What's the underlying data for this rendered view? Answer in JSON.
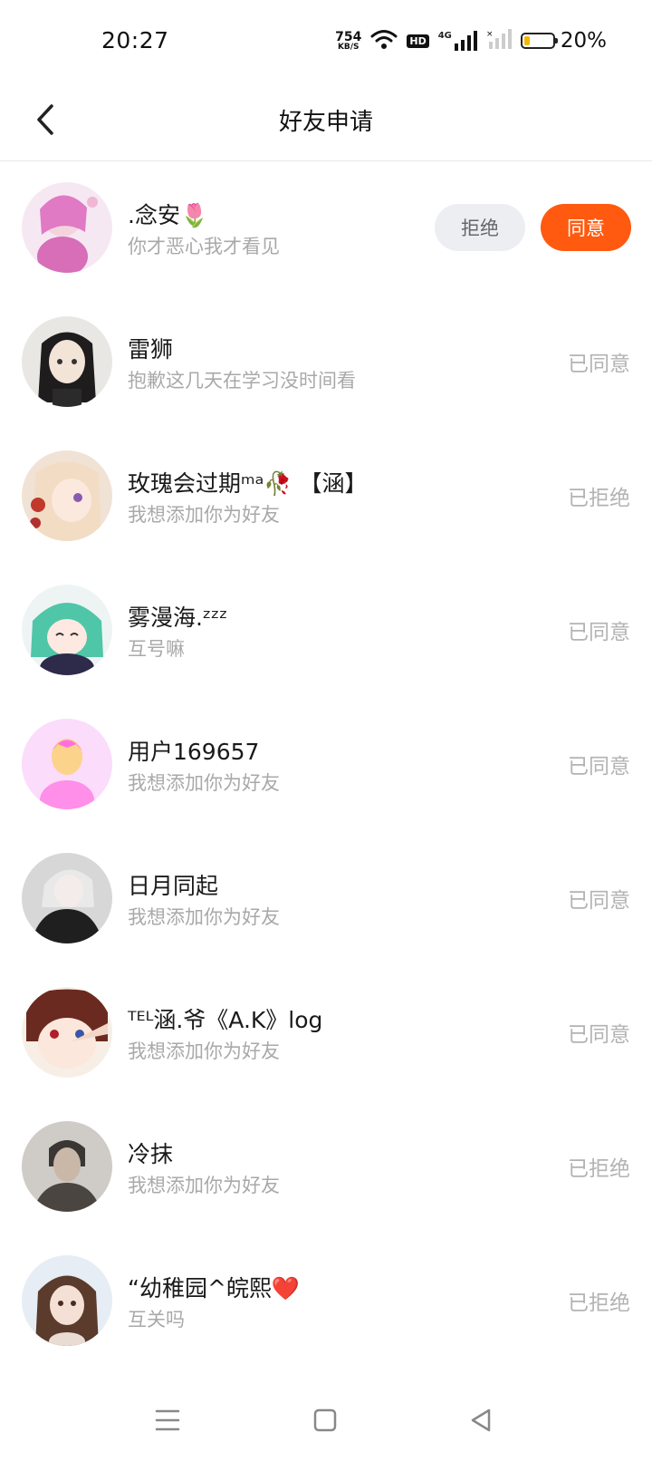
{
  "status_bar": {
    "time": "20:27",
    "net_speed_value": "754",
    "net_speed_unit": "KB/S",
    "hd_label": "HD",
    "signal_label": "4G",
    "battery_percent": "20%",
    "battery_level": 0.2,
    "battery_color": "#f2b705"
  },
  "header": {
    "title": "好友申请",
    "back_icon": "chevron-left-icon"
  },
  "colors": {
    "accent": "#ff5a10",
    "reject_bg": "#eceef2",
    "status_text": "#b3b3b3"
  },
  "requests": [
    {
      "name": ".念安🌷",
      "message": "你才恶心我才看见",
      "reject_label": "拒绝",
      "accept_label": "同意"
    },
    {
      "name": "雷狮",
      "message": "抱歉这几天在学习没时间看",
      "status": "已同意"
    },
    {
      "name": "玫瑰会过期ᵐᵃ🥀 【涵】",
      "message": "我想添加你为好友",
      "status": "已拒绝"
    },
    {
      "name": "雾漫海.ᶻᶻᶻ",
      "message": "互号嘛",
      "status": "已同意"
    },
    {
      "name": "用户169657",
      "message": "我想添加你为好友",
      "status": "已同意"
    },
    {
      "name": "日月同起",
      "message": "我想添加你为好友",
      "status": "已同意"
    },
    {
      "name": "ᵀᴱᴸ涵.爷《A.K》log",
      "message": "我想添加你为好友",
      "status": "已同意"
    },
    {
      "name": "冷抹",
      "message": "我想添加你为好友",
      "status": "已拒绝"
    },
    {
      "name": "“幼稚园^皖熙❤️",
      "message": "互关吗",
      "status": "已拒绝"
    }
  ],
  "navbar": {
    "menu_icon": "menu-icon",
    "home_icon": "home-square-icon",
    "back_icon": "back-triangle-icon"
  }
}
